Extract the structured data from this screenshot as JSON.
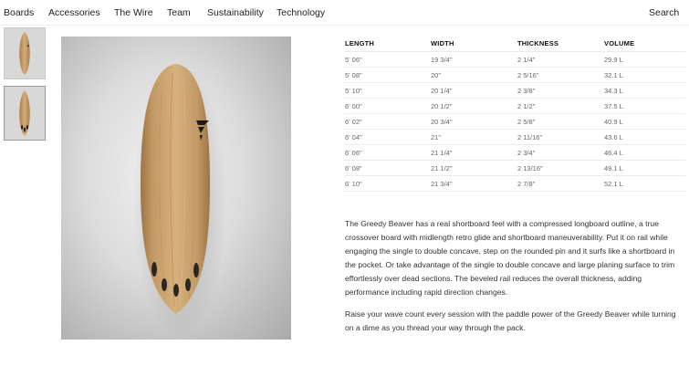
{
  "nav": {
    "items": [
      "Boards",
      "Accessories",
      "The Wire",
      "Team",
      "Sustainability",
      "Technology"
    ],
    "search_label": "Search"
  },
  "gallery": {
    "thumbnails": [
      {
        "name": "thumb-board-deck",
        "selected": false
      },
      {
        "name": "thumb-board-bottom",
        "selected": true
      }
    ]
  },
  "specs": {
    "headers": [
      "LENGTH",
      "WIDTH",
      "THICKNESS",
      "VOLUME"
    ],
    "rows": [
      [
        "5' 06\"",
        "19 3/4\"",
        "2 1/4\"",
        "29.9 L"
      ],
      [
        "5' 08\"",
        "20\"",
        "2 5/16\"",
        "32.1 L"
      ],
      [
        "5' 10\"",
        "20 1/4\"",
        "2 3/8\"",
        "34.3 L"
      ],
      [
        "6' 00\"",
        "20 1/2\"",
        "2 1/2\"",
        "37.5 L"
      ],
      [
        "6' 02\"",
        "20 3/4\"",
        "2 5/8\"",
        "40.9 L"
      ],
      [
        "6' 04\"",
        "21\"",
        "2 11/16\"",
        "43.6 L"
      ],
      [
        "6' 06\"",
        "21 1/4\"",
        "2 3/4\"",
        "46.4 L"
      ],
      [
        "6' 08\"",
        "21 1/2\"",
        "2 13/16\"",
        "49.1 L"
      ],
      [
        "6' 10\"",
        "21 3/4\"",
        "2 7/8\"",
        "52.1 L"
      ]
    ]
  },
  "description": {
    "paragraph1": "The Greedy Beaver has a real shortboard feel with a compressed longboard outline, a true crossover board with midlength retro glide and shortboard maneuverability. Put it on rail while engaging the single to double concave, step on the rounded pin and it surfs like a shortboard in the pocket. Or take advantage of the single to double concave and large planing surface to trim effortlessly over dead sections. The beveled rail reduces the overall thickness, adding performance including rapid direction changes.",
    "paragraph2": "Raise your wave count every session with the paddle power of the Greedy Beaver while turning on a dime as you thread your way through the pack."
  },
  "colors": {
    "board_wood": "#c9a36f",
    "board_wood_dark": "#a97f4d",
    "fins": "#2a2622",
    "logo": "#1d1b19"
  }
}
